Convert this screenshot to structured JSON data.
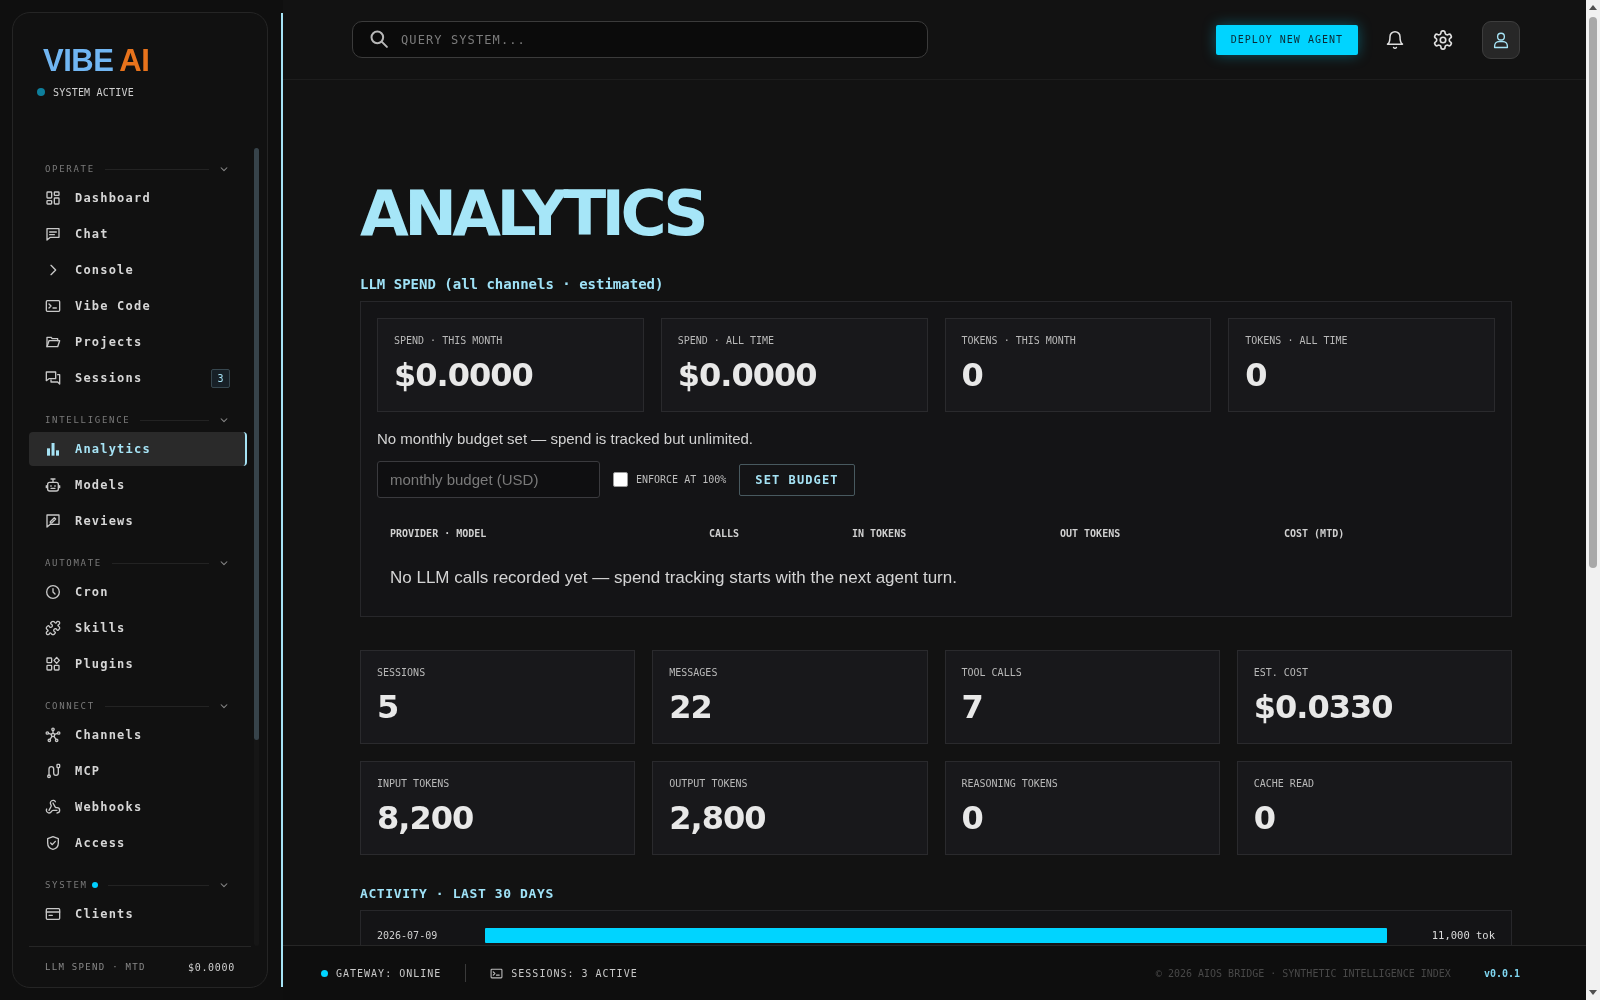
{
  "sidebar": {
    "logo": {
      "text": "VIBE",
      "accent": "AI"
    },
    "status": {
      "label": "SYSTEM ACTIVE",
      "active": true
    },
    "sections": [
      {
        "title": "OPERATE",
        "expanded": true,
        "indicator": false,
        "items": [
          {
            "label": "Dashboard",
            "selected": false
          },
          {
            "label": "Chat",
            "selected": false
          },
          {
            "label": "Console",
            "selected": false
          },
          {
            "label": "Vibe Code",
            "selected": false
          },
          {
            "label": "Projects",
            "selected": false
          },
          {
            "label": "Sessions",
            "selected": false,
            "badge": "3"
          }
        ]
      },
      {
        "title": "INTELLIGENCE",
        "expanded": true,
        "indicator": false,
        "items": [
          {
            "label": "Analytics",
            "selected": true
          },
          {
            "label": "Models",
            "selected": false
          },
          {
            "label": "Reviews",
            "selected": false
          }
        ]
      },
      {
        "title": "AUTOMATE",
        "expanded": true,
        "indicator": false,
        "items": [
          {
            "label": "Cron",
            "selected": false
          },
          {
            "label": "Skills",
            "selected": false
          },
          {
            "label": "Plugins",
            "selected": false
          }
        ]
      },
      {
        "title": "CONNECT",
        "expanded": true,
        "indicator": false,
        "items": [
          {
            "label": "Channels",
            "selected": false
          },
          {
            "label": "MCP",
            "selected": false
          },
          {
            "label": "Webhooks",
            "selected": false
          },
          {
            "label": "Access",
            "selected": false
          }
        ]
      },
      {
        "title": "SYSTEM",
        "expanded": true,
        "indicator": true,
        "items": [
          {
            "label": "Clients",
            "selected": false
          }
        ]
      }
    ],
    "footer": {
      "label": "LLM SPEND · MTD",
      "value": "$0.0000"
    }
  },
  "topbar": {
    "search": {
      "placeholder": "QUERY SYSTEM..."
    },
    "deploy_button": "DEPLOY NEW AGENT"
  },
  "page_title": "ANALYTICS",
  "llm_spend": {
    "title": "LLM SPEND (all channels · estimated)",
    "cards": [
      {
        "label": "SPEND · THIS MONTH",
        "value": "$0.0000"
      },
      {
        "label": "SPEND · ALL TIME",
        "value": "$0.0000"
      },
      {
        "label": "TOKENS · THIS MONTH",
        "value": "0"
      },
      {
        "label": "TOKENS · ALL TIME",
        "value": "0"
      }
    ],
    "budget_note": "No monthly budget set — spend is tracked but unlimited.",
    "budget_input": {
      "placeholder": "monthly budget (USD)"
    },
    "enforce": {
      "label": "ENFORCE AT 100%",
      "checked": false
    },
    "set_budget_button": "SET BUDGET",
    "table": {
      "columns": [
        "PROVIDER · MODEL",
        "CALLS",
        "IN TOKENS",
        "OUT TOKENS",
        "COST (MTD)"
      ],
      "empty_message": "No LLM calls recorded yet — spend tracking starts with the next agent turn."
    }
  },
  "stats": [
    {
      "label": "SESSIONS",
      "value": "5"
    },
    {
      "label": "MESSAGES",
      "value": "22"
    },
    {
      "label": "TOOL CALLS",
      "value": "7"
    },
    {
      "label": "EST. COST",
      "value": "$0.0330"
    },
    {
      "label": "INPUT TOKENS",
      "value": "8,200"
    },
    {
      "label": "OUTPUT TOKENS",
      "value": "2,800"
    },
    {
      "label": "REASONING TOKENS",
      "value": "0"
    },
    {
      "label": "CACHE READ",
      "value": "0"
    }
  ],
  "activity": {
    "title": "ACTIVITY · LAST 30 DAYS",
    "rows": [
      {
        "date": "2026-07-09",
        "level": 1.0,
        "reading": "11,000 tok"
      }
    ]
  },
  "status_bar": {
    "gateway": {
      "label": "GATEWAY: ONLINE",
      "online": true
    },
    "sessions": "SESSIONS: 3 ACTIVE",
    "copyright": "© 2026 AIOS BRIDGE · SYNTHETIC INTELLIGENCE INDEX",
    "version": "v0.0.1"
  }
}
